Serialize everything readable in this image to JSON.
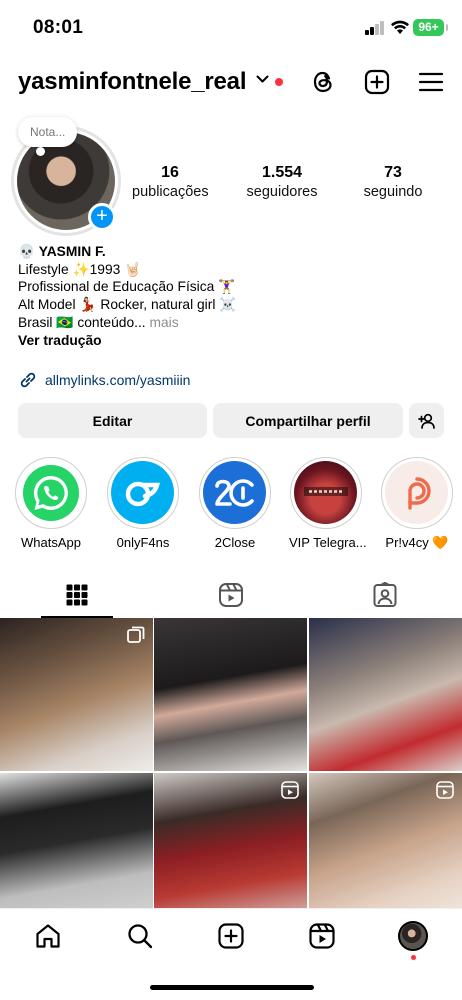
{
  "status_bar": {
    "time": "08:01",
    "battery": "96+"
  },
  "header": {
    "username": "yasminfontnele_real"
  },
  "profile": {
    "note_placeholder": "Nota...",
    "stats": [
      {
        "value": "16",
        "label": "publicações"
      },
      {
        "value": "1.554",
        "label": "seguidores"
      },
      {
        "value": "73",
        "label": "seguindo"
      }
    ]
  },
  "bio": {
    "name": "💀 YASMIN F.",
    "lines": [
      "Lifestyle ✨1993 🤘🏻",
      "Profissional de Educação Física 🏋️‍♀️",
      "Alt Model 💃🏻 Rocker, natural girl ☠️"
    ],
    "truncated_line": "Brasil 🇧🇷 conteúdo...",
    "more": "mais",
    "translate": "Ver tradução",
    "link": "allmylinks.com/yasmiiin"
  },
  "buttons": {
    "edit": "Editar",
    "share": "Compartilhar perfil"
  },
  "highlights": [
    {
      "label": "WhatsApp",
      "icon": "whatsapp-icon",
      "color": "#25d366"
    },
    {
      "label": "0nlyF4ns",
      "icon": "onlyfans-icon",
      "color": "#00aff0"
    },
    {
      "label": "2Close",
      "icon": "twoclose-icon",
      "color": "#1d6fd8"
    },
    {
      "label": "VIP Telegra...",
      "icon": "telegram-vip-icon",
      "color": "#7a1f2a"
    },
    {
      "label": "Pr!v4cy 🧡",
      "icon": "privacy-icon",
      "color": "#f06b4a"
    }
  ],
  "colors": {
    "accent": "#0095f6",
    "link": "#00376b",
    "notification": "#ff3040"
  }
}
